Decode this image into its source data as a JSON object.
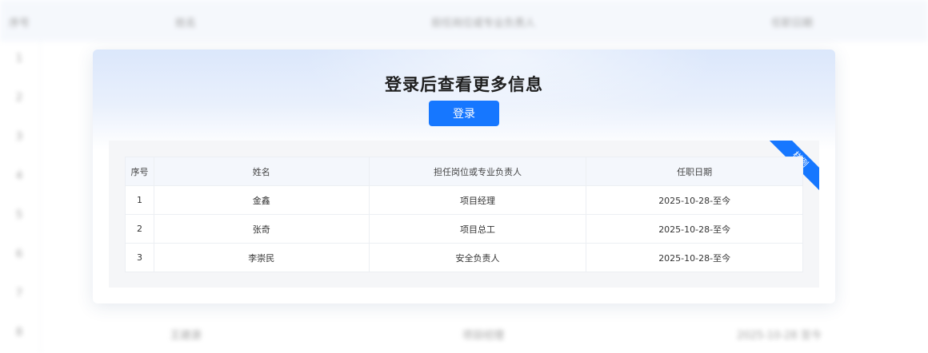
{
  "background": {
    "headers": [
      "序号",
      "姓名",
      "担任岗位或专业负责人",
      "任职日期"
    ],
    "row_numbers": [
      "1",
      "2",
      "3",
      "4",
      "5",
      "6",
      "7",
      "8"
    ],
    "last_row": [
      "8",
      "王建源",
      "项目经理",
      "2025-10-28 至今"
    ]
  },
  "modal": {
    "title": "登录后查看更多信息",
    "login_label": "登录"
  },
  "sample": {
    "ribbon": "样例",
    "headers": [
      "序号",
      "姓名",
      "担任岗位或专业负责人",
      "任职日期"
    ],
    "rows": [
      [
        "1",
        "金鑫",
        "项目经理",
        "2025-10-28-至今"
      ],
      [
        "2",
        "张奇",
        "项目总工",
        "2025-10-28-至今"
      ],
      [
        "3",
        "李崇民",
        "安全负责人",
        "2025-10-28-至今"
      ]
    ]
  },
  "colors": {
    "primary": "#1677ff",
    "header_bg": "#f4f7fc",
    "panel_bg": "#f5f6f8"
  }
}
